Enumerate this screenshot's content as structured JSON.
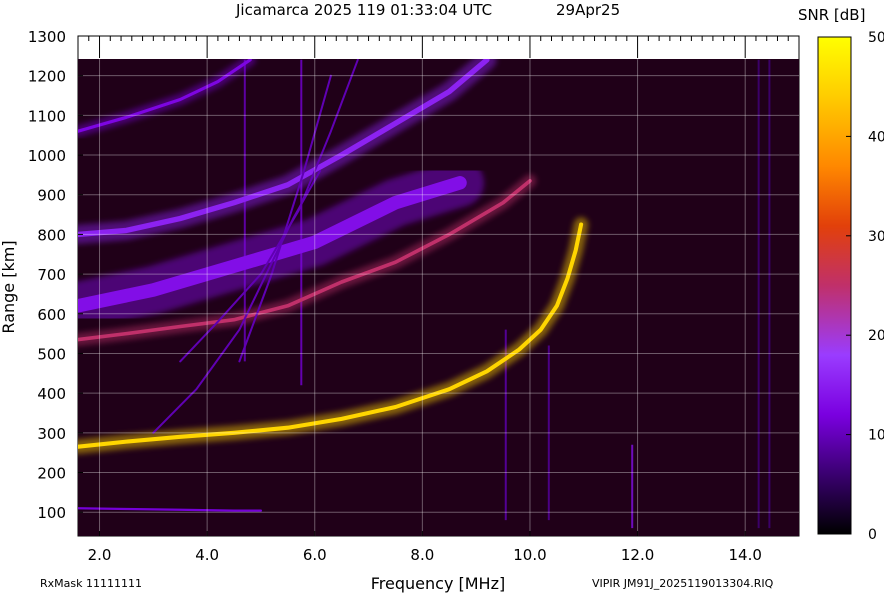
{
  "header": {
    "title": "Jicamarca 2025 119 01:33:04 UTC",
    "date": "29Apr25"
  },
  "footer": {
    "rx_mask": "RxMask 11111111",
    "file": "VIPIR  JM91J_2025119013304.RIQ"
  },
  "colorbar": {
    "label": "SNR [dB]",
    "ticks": [
      "0",
      "10",
      "20",
      "30",
      "40",
      "50"
    ],
    "min": 0,
    "max": 50,
    "colormap": [
      "#000000",
      "#3a0070",
      "#7a00e0",
      "#9a3cff",
      "#c0306a",
      "#e2400a",
      "#ff8800",
      "#ffcc00",
      "#ffff00"
    ]
  },
  "chart_data": {
    "type": "heatmap",
    "title": "Jicamarca 2025 119 01:33:04 UTC",
    "xlabel": "Frequency [MHz]",
    "ylabel": "Range [km]",
    "xlim": [
      1.6,
      15.0
    ],
    "ylim": [
      40,
      1300
    ],
    "x_ticks": [
      "2.0",
      "4.0",
      "6.0",
      "8.0",
      "10.0",
      "12.0",
      "14.0"
    ],
    "y_ticks": [
      "100",
      "200",
      "300",
      "400",
      "500",
      "600",
      "700",
      "800",
      "900",
      "1000",
      "1100",
      "1200",
      "1300"
    ],
    "x_tick_values": [
      2,
      4,
      6,
      8,
      10,
      12,
      14
    ],
    "y_tick_values": [
      100,
      200,
      300,
      400,
      500,
      600,
      700,
      800,
      900,
      1000,
      1100,
      1200,
      1300
    ],
    "grid": true,
    "background": "#200018",
    "traces": [
      {
        "name": "",
        "snr": 45,
        "width": 9,
        "points": [
          [
            1.6,
            265
          ],
          [
            2.5,
            278
          ],
          [
            3.5,
            290
          ],
          [
            4.5,
            300
          ],
          [
            5.5,
            313
          ],
          [
            6.5,
            335
          ],
          [
            7.5,
            365
          ],
          [
            8.5,
            410
          ],
          [
            9.2,
            455
          ],
          [
            9.8,
            510
          ],
          [
            10.2,
            560
          ],
          [
            10.5,
            620
          ],
          [
            10.7,
            690
          ],
          [
            10.85,
            760
          ],
          [
            10.95,
            825
          ]
        ]
      },
      {
        "name": "",
        "snr": 25,
        "width": 8,
        "points": [
          [
            1.6,
            535
          ],
          [
            2.5,
            550
          ],
          [
            3.5,
            568
          ],
          [
            4.5,
            585
          ],
          [
            5.5,
            620
          ],
          [
            6.5,
            680
          ],
          [
            7.5,
            730
          ],
          [
            8.5,
            800
          ],
          [
            9.5,
            880
          ],
          [
            10.0,
            935
          ]
        ]
      },
      {
        "name": "",
        "snr": 14,
        "width": 30,
        "points": [
          [
            1.6,
            620
          ],
          [
            3.0,
            660
          ],
          [
            4.5,
            720
          ],
          [
            6.0,
            780
          ],
          [
            7.5,
            880
          ],
          [
            8.7,
            930
          ]
        ]
      },
      {
        "name": "",
        "snr": 16,
        "width": 12,
        "points": [
          [
            1.6,
            800
          ],
          [
            2.5,
            810
          ],
          [
            3.5,
            840
          ],
          [
            4.5,
            880
          ],
          [
            5.5,
            925
          ],
          [
            6.5,
            1000
          ],
          [
            7.5,
            1080
          ],
          [
            8.5,
            1160
          ],
          [
            9.2,
            1240
          ]
        ]
      },
      {
        "name": "",
        "snr": 13,
        "width": 7,
        "points": [
          [
            1.6,
            1060
          ],
          [
            2.5,
            1095
          ],
          [
            3.5,
            1140
          ],
          [
            4.2,
            1185
          ],
          [
            4.8,
            1240
          ]
        ]
      },
      {
        "name": "",
        "snr": 12,
        "width": 5,
        "points": [
          [
            1.6,
            110
          ],
          [
            2.5,
            108
          ],
          [
            3.5,
            106
          ],
          [
            4.5,
            104
          ],
          [
            5.0,
            104
          ]
        ]
      },
      {
        "name": "",
        "snr": 10,
        "width": 2,
        "points": [
          [
            3.0,
            300
          ],
          [
            3.8,
            410
          ],
          [
            4.6,
            560
          ],
          [
            5.1,
            700
          ],
          [
            5.6,
            840
          ],
          [
            6.1,
            960
          ]
        ]
      },
      {
        "name": "",
        "snr": 10,
        "width": 2,
        "points": [
          [
            3.5,
            480
          ],
          [
            4.2,
            580
          ],
          [
            5.0,
            700
          ],
          [
            5.7,
            860
          ],
          [
            6.3,
            1060
          ],
          [
            6.8,
            1240
          ]
        ]
      },
      {
        "name": "",
        "snr": 10,
        "width": 2,
        "points": [
          [
            4.6,
            480
          ],
          [
            5.2,
            700
          ],
          [
            5.8,
            960
          ],
          [
            6.3,
            1200
          ]
        ]
      }
    ],
    "vertical_streaks": [
      {
        "x": 4.7,
        "y0": 480,
        "y1": 1240,
        "snr": 11
      },
      {
        "x": 5.75,
        "y0": 420,
        "y1": 1240,
        "snr": 12
      },
      {
        "x": 9.55,
        "y0": 80,
        "y1": 560,
        "snr": 10
      },
      {
        "x": 10.35,
        "y0": 80,
        "y1": 520,
        "snr": 9
      },
      {
        "x": 11.9,
        "y0": 60,
        "y1": 270,
        "snr": 14
      },
      {
        "x": 14.25,
        "y0": 60,
        "y1": 1240,
        "snr": 7
      },
      {
        "x": 14.45,
        "y0": 60,
        "y1": 1240,
        "snr": 7
      }
    ]
  }
}
